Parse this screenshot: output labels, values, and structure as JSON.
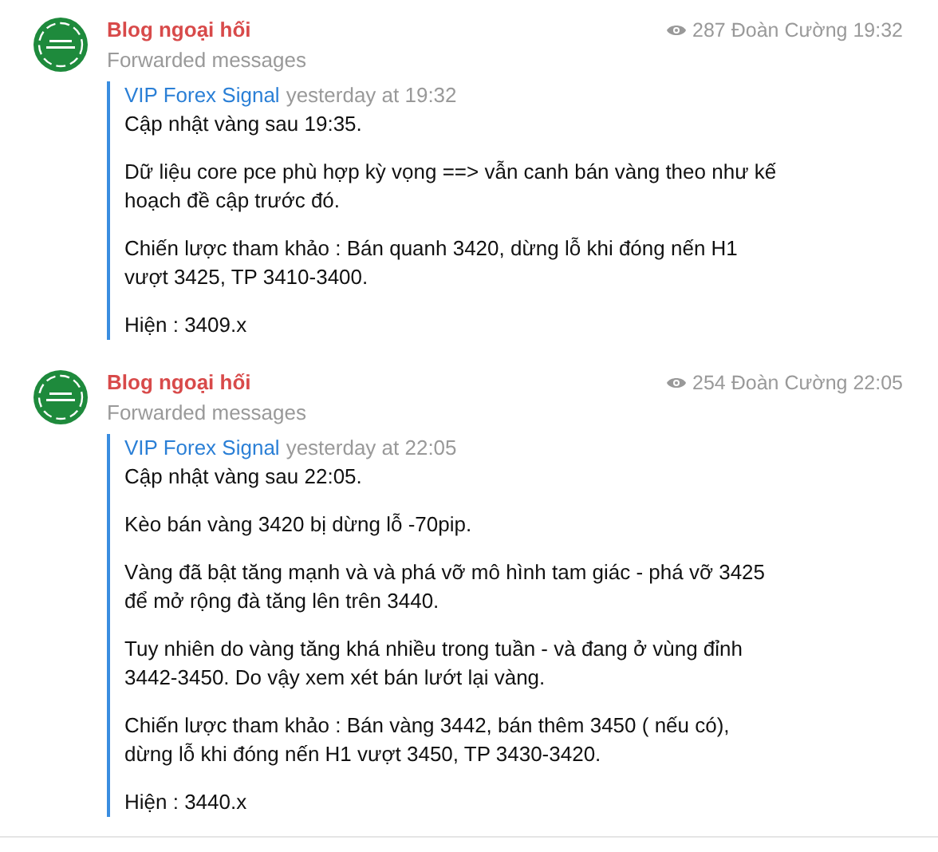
{
  "messages": [
    {
      "sender": "Blog ngoại hối",
      "subtitle": "Forwarded messages",
      "views": "287",
      "author": "Đoàn Cường",
      "time": "19:32",
      "forward_from": "VIP Forex Signal",
      "forward_time": "yesterday at 19:32",
      "paragraphs": [
        "Cập nhật vàng sau 19:35.",
        "Dữ liệu core pce phù hợp kỳ vọng ==> vẫn canh bán vàng theo như kế\nhoạch đề cập trước đó.",
        "Chiến lược tham khảo : Bán quanh 3420, dừng lỗ khi đóng nến H1\nvượt 3425, TP 3410-3400.",
        "Hiện : 3409.x"
      ]
    },
    {
      "sender": "Blog ngoại hối",
      "subtitle": "Forwarded messages",
      "views": "254",
      "author": "Đoàn Cường",
      "time": "22:05",
      "forward_from": "VIP Forex Signal",
      "forward_time": "yesterday at 22:05",
      "paragraphs": [
        "Cập nhật vàng sau 22:05.",
        "Kèo bán vàng 3420 bị dừng lỗ -70pip.",
        "Vàng đã bật tăng mạnh và và phá vỡ mô hình tam giác - phá vỡ 3425\nđể mở rộng đà tăng lên trên 3440.",
        "Tuy nhiên do vàng tăng khá nhiều trong tuần - và đang ở vùng đỉnh\n3442-3450. Do vậy xem xét bán lướt lại vàng.",
        "Chiến lược tham khảo : Bán vàng 3442, bán thêm 3450 ( nếu có),\ndừng lỗ khi đóng nến H1 vượt 3450, TP 3430-3420.",
        "Hiện : 3440.x"
      ]
    }
  ]
}
